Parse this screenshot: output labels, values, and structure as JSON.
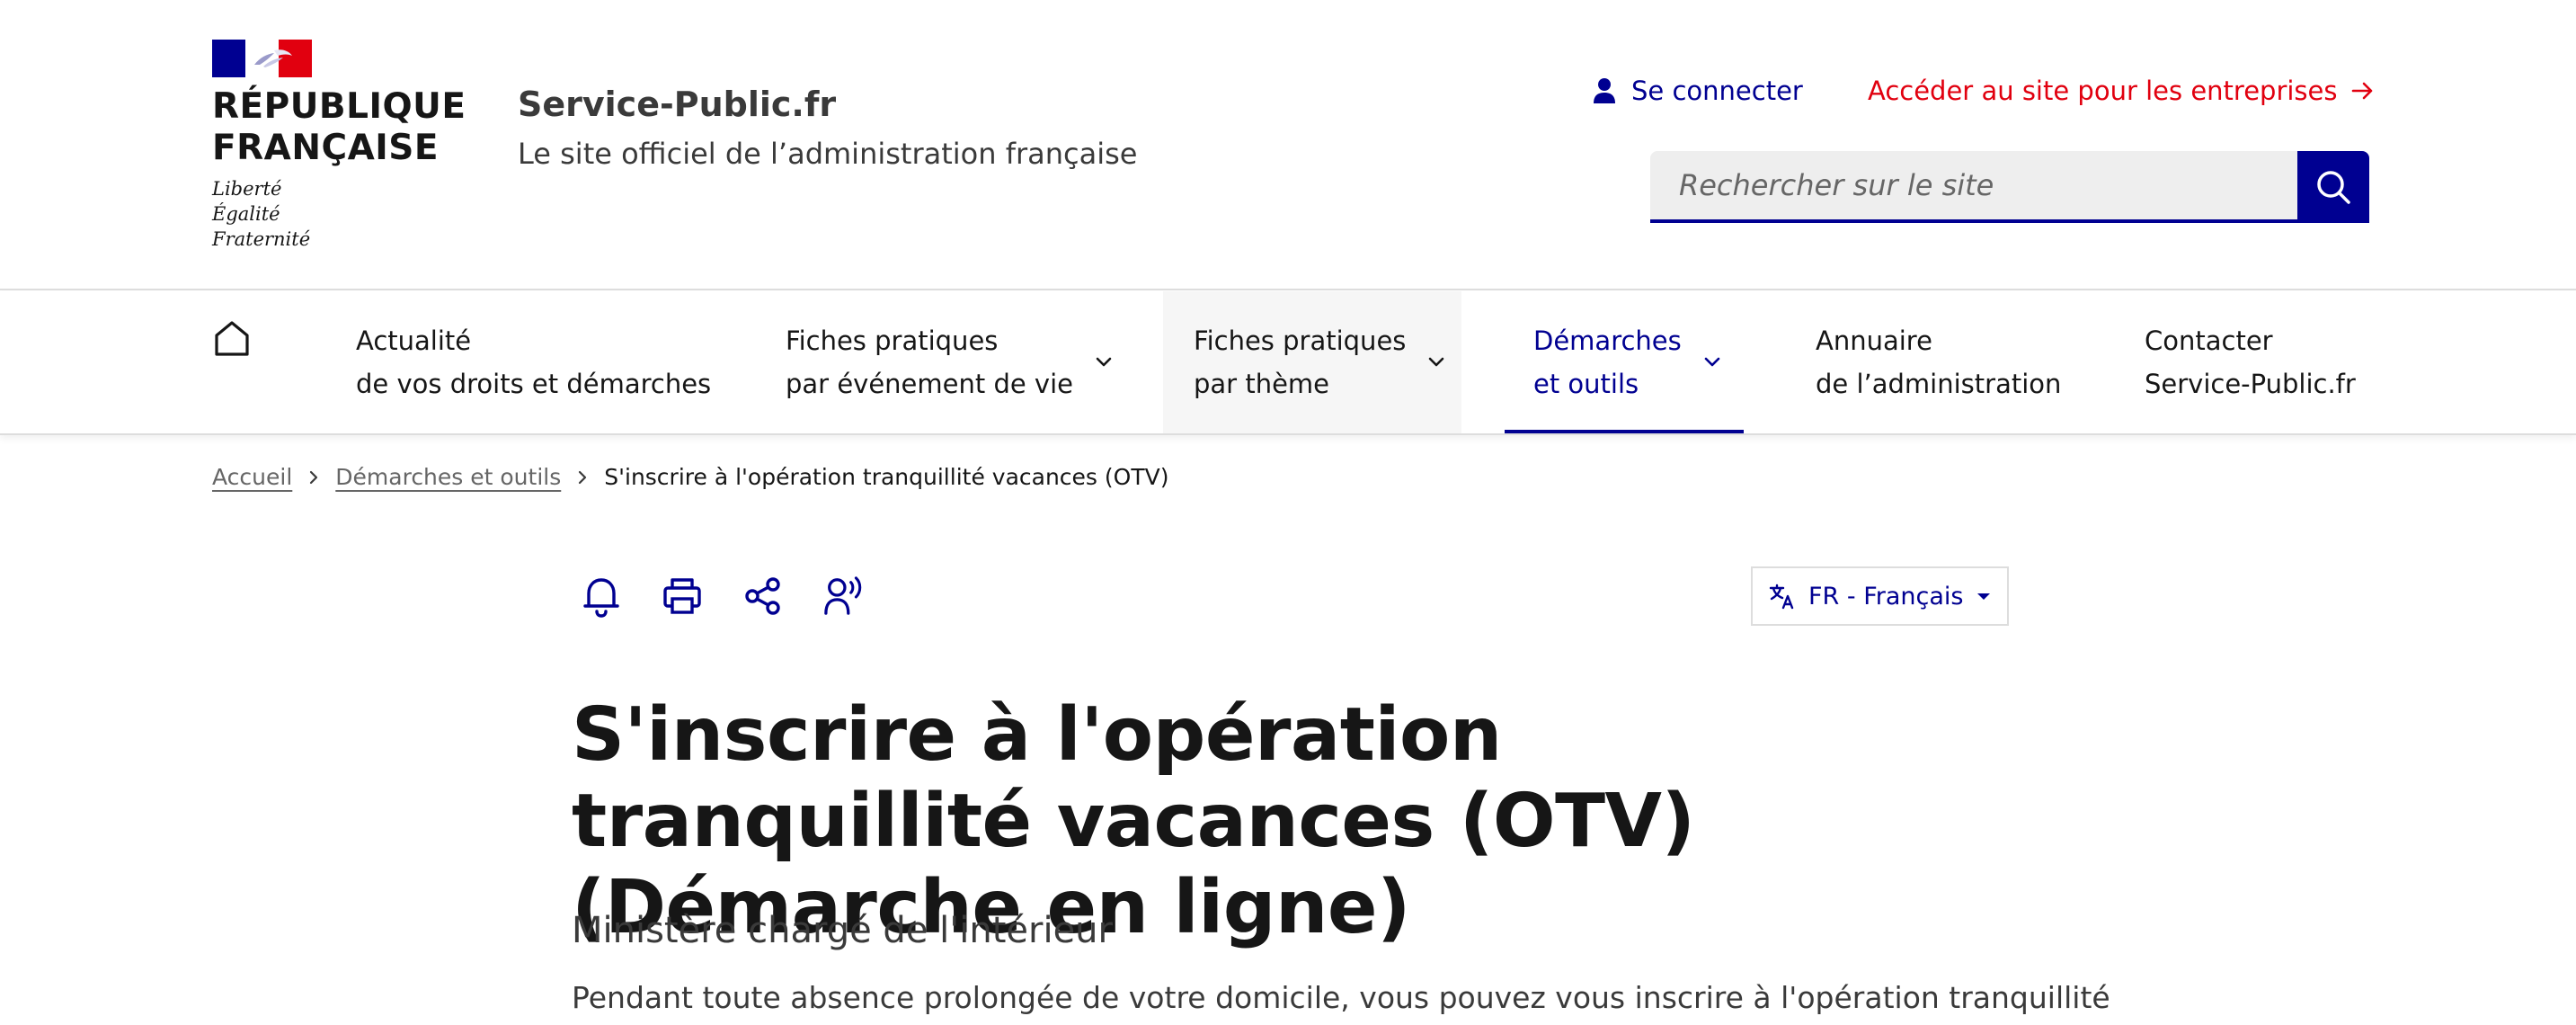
{
  "colors": {
    "blue_france": "#000091",
    "red_marianne": "#e1000f",
    "text": "#161616",
    "text_muted": "#3a3a3a",
    "border": "#dddddd"
  },
  "brand": {
    "name_line1": "RÉPUBLIQUE",
    "name_line2": "FRANÇAISE",
    "motto_line1": "Liberté",
    "motto_line2": "Égalité",
    "motto_line3": "Fraternité",
    "site_title": "Service-Public.fr",
    "site_tagline": "Le site officiel de l’administration française"
  },
  "header": {
    "connect_label": "Se connecter",
    "connect_icon": "user-icon",
    "pro_link_label": "Accéder au site pour les entreprises",
    "pro_link_icon": "arrow-right-icon",
    "search_placeholder": "Rechercher sur le site",
    "search_icon": "search-icon"
  },
  "nav": {
    "home_icon": "home-icon",
    "items": [
      {
        "line1": "Actualité",
        "line2": "de vos droits et démarches",
        "has_dropdown": false,
        "active": false
      },
      {
        "line1": "Fiches pratiques",
        "line2": "par événement de vie",
        "has_dropdown": true,
        "active": false
      },
      {
        "line1": "Fiches pratiques",
        "line2": "par thème",
        "has_dropdown": true,
        "active": false
      },
      {
        "line1": "Démarches",
        "line2": "et outils",
        "has_dropdown": true,
        "active": true
      },
      {
        "line1": "Annuaire",
        "line2": "de l’administration",
        "has_dropdown": false,
        "active": false
      },
      {
        "line1": "Contacter",
        "line2": "Service-Public.fr",
        "has_dropdown": false,
        "active": false
      }
    ]
  },
  "breadcrumb": {
    "items": [
      "Accueil",
      "Démarches et outils"
    ],
    "current": "S'inscrire à l'opération tranquillité vacances (OTV)"
  },
  "toolbar": {
    "icons": [
      "bell-icon",
      "print-icon",
      "share-icon",
      "listen-icon"
    ],
    "language_label": "FR - Français",
    "language_icon": "translate-icon"
  },
  "content": {
    "title": "S'inscrire à l'opération tranquillité vacances (OTV) (Démarche en ligne)",
    "ministry": "Ministère chargé de l'intérieur",
    "intro": "Pendant toute absence prolongée de votre domicile, vous pouvez vous inscrire à l'opération tranquillité"
  }
}
